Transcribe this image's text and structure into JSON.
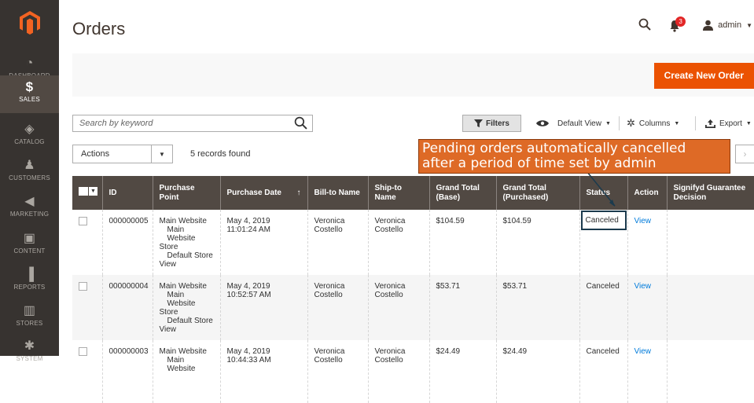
{
  "sidebar": {
    "items": [
      {
        "label": "DASHBOARD",
        "icon": "dashboard-icon"
      },
      {
        "label": "SALES",
        "icon": "dollar-icon",
        "active": true
      },
      {
        "label": "CATALOG",
        "icon": "box-icon"
      },
      {
        "label": "CUSTOMERS",
        "icon": "person-icon"
      },
      {
        "label": "MARKETING",
        "icon": "megaphone-icon"
      },
      {
        "label": "CONTENT",
        "icon": "layout-icon"
      },
      {
        "label": "REPORTS",
        "icon": "bar-chart-icon"
      },
      {
        "label": "STORES",
        "icon": "storefront-icon"
      },
      {
        "label": "SYSTEM",
        "icon": "gear-icon"
      }
    ]
  },
  "header": {
    "title": "Orders",
    "notifications_count": "3",
    "user": "admin",
    "create_button": "Create New Order"
  },
  "toolbar": {
    "search_placeholder": "Search by keyword",
    "filters_label": "Filters",
    "view_label": "Default View",
    "columns_label": "Columns",
    "export_label": "Export",
    "actions_label": "Actions",
    "records_found": "5 records found"
  },
  "callout": {
    "line1": "Pending orders automatically cancelled",
    "line2": "after a period of time set by admin"
  },
  "table": {
    "columns": [
      "ID",
      "Purchase Point",
      "Purchase Date",
      "Bill-to Name",
      "Ship-to Name",
      "Grand Total (Base)",
      "Grand Total (Purchased)",
      "Status",
      "Action",
      "Signifyd Guarantee Decision"
    ],
    "sort_indicator": "↑",
    "rows": [
      {
        "id": "000000005",
        "pp1": "Main Website",
        "pp2": "Main Website",
        "pp3": "Store",
        "pp4": "Default Store",
        "pp5": "View",
        "date1": "May 4, 2019",
        "date2": "11:01:24 AM",
        "bill1": "Veronica",
        "bill2": "Costello",
        "ship1": "Veronica",
        "ship2": "Costello",
        "base": "$104.59",
        "purchased": "$104.59",
        "status": "Canceled",
        "action": "View"
      },
      {
        "id": "000000004",
        "pp1": "Main Website",
        "pp2": "Main Website",
        "pp3": "Store",
        "pp4": "Default Store",
        "pp5": "View",
        "date1": "May 4, 2019",
        "date2": "10:52:57 AM",
        "bill1": "Veronica",
        "bill2": "Costello",
        "ship1": "Veronica",
        "ship2": "Costello",
        "base": "$53.71",
        "purchased": "$53.71",
        "status": "Canceled",
        "action": "View"
      },
      {
        "id": "000000003",
        "pp1": "Main Website",
        "pp2": "Main Website",
        "pp3": "",
        "pp4": "",
        "pp5": "",
        "date1": "May 4, 2019",
        "date2": "10:44:33 AM",
        "bill1": "Veronica",
        "bill2": "Costello",
        "ship1": "Veronica",
        "ship2": "Costello",
        "base": "$24.49",
        "purchased": "$24.49",
        "status": "Canceled",
        "action": "View"
      }
    ]
  }
}
